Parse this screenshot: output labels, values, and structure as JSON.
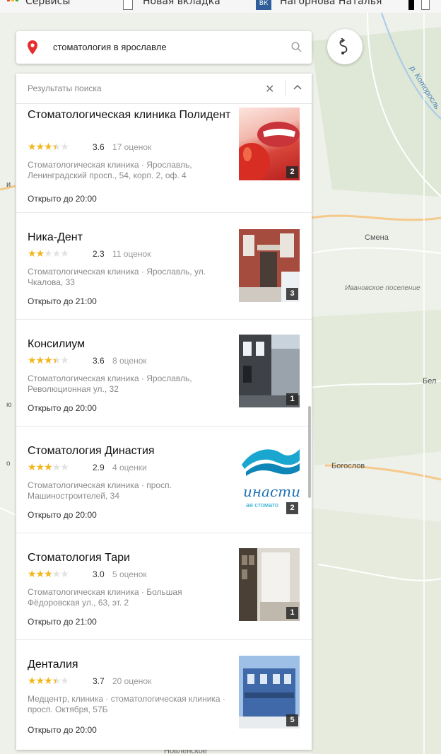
{
  "bookmarks": [
    "Сервисы",
    "Новая вкладка",
    "Нагорнова Наталья"
  ],
  "search": {
    "value": "стоматология в ярославле"
  },
  "panel": {
    "title": "Результаты поиска"
  },
  "map_labels": {
    "river": "р. Которосль",
    "smena": "Смена",
    "ivan": "Ивановское поселение",
    "bel": "Бел",
    "bogos": "Богослов",
    "novl": "Новленское",
    "edge_i": "и",
    "edge_o": "ю",
    "edge_o2": "о"
  },
  "colors": {
    "star": "#f2b61a",
    "pin": "#e52e2e",
    "map": "#eef0ea",
    "road": "#f5c98a"
  },
  "results": [
    {
      "name": "Стоматологическая клиника Полидент",
      "rating": 3.6,
      "rating_label": "3.6",
      "reviews": "17 оценок",
      "address": "Стоматологическая клиника · Ярославль, Ленинградский просп., 54, корп. 2, оф. 4",
      "hours": "Открыто до 20:00",
      "photos": "2",
      "photo_icon": "teeth-apple-photo"
    },
    {
      "name": "Ника-Дент",
      "rating": 2.3,
      "rating_label": "2.3",
      "reviews": "11 оценок",
      "address": "Стоматологическая клиника · Ярославль, ул. Чкалова, 33",
      "hours": "Открыто до 21:00",
      "photos": "3",
      "photo_icon": "building-entrance-photo"
    },
    {
      "name": "Консилиум",
      "rating": 3.6,
      "rating_label": "3.6",
      "reviews": "8 оценок",
      "address": "Стоматологическая клиника · Ярославль, Революционная ул., 32",
      "hours": "Открыто до 20:00",
      "photos": "1",
      "photo_icon": "street-facade-photo"
    },
    {
      "name": "Стоматология Династия",
      "rating": 2.9,
      "rating_label": "2.9",
      "reviews": "4 оценки",
      "address": "Стоматологическая клиника · просп. Машиностроителей, 34",
      "hours": "Открыто до 20:00",
      "photos": "2",
      "photo_icon": "dynasty-logo-photo",
      "photo_text": "инасти",
      "photo_subtext": "ая стомато"
    },
    {
      "name": "Стоматология Тари",
      "rating": 3.0,
      "rating_label": "3.0",
      "reviews": "5 оценок",
      "address": "Стоматологическая клиника · Большая Фёдоровская ул., 63, эт. 2",
      "hours": "Открыто до 21:00",
      "photos": "1",
      "photo_icon": "interior-photo"
    },
    {
      "name": "Денталия",
      "rating": 3.7,
      "rating_label": "3.7",
      "reviews": "20 оценок",
      "address": "Медцентр, клиника · стоматологическая клиника · просп. Октября, 57Б",
      "hours": "Открыто до 20:00",
      "photos": "5",
      "photo_icon": "blue-building-photo"
    }
  ]
}
